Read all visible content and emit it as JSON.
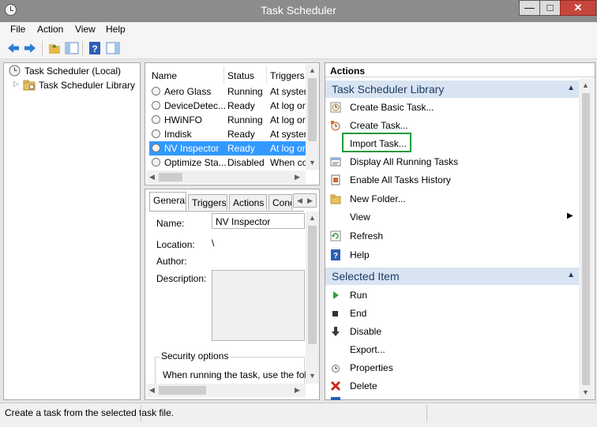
{
  "window": {
    "title": "Task Scheduler"
  },
  "menu": [
    "File",
    "Action",
    "View",
    "Help"
  ],
  "tree": {
    "root": "Task Scheduler (Local)",
    "child": "Task Scheduler Library"
  },
  "tasks": {
    "columns": [
      "Name",
      "Status",
      "Triggers"
    ],
    "rows": [
      {
        "name": "Aero Glass",
        "status": "Running",
        "triggers": "At systen",
        "selected": false
      },
      {
        "name": "DeviceDetec...",
        "status": "Ready",
        "triggers": "At log or",
        "selected": false
      },
      {
        "name": "HWiNFO",
        "status": "Running",
        "triggers": "At log or",
        "selected": false
      },
      {
        "name": "Imdisk",
        "status": "Ready",
        "triggers": "At systen",
        "selected": false
      },
      {
        "name": "NV Inspector",
        "status": "Ready",
        "triggers": "At log or",
        "selected": true
      },
      {
        "name": "Optimize Sta...",
        "status": "Disabled",
        "triggers": "When co",
        "selected": false
      }
    ]
  },
  "detail": {
    "tabs": [
      "General",
      "Triggers",
      "Actions",
      "Conc"
    ],
    "name_label": "Name:",
    "name_value": "NV Inspector",
    "location_label": "Location:",
    "location_value": "\\",
    "author_label": "Author:",
    "description_label": "Description:",
    "security_label": "Security options",
    "security_text": "When running the task, use the follo"
  },
  "actions": {
    "header": "Actions",
    "section1_title": "Task Scheduler Library",
    "section1_items": [
      "Create Basic Task...",
      "Create Task...",
      "Import Task...",
      "Display All Running Tasks",
      "Enable All Tasks History",
      "New Folder...",
      "View",
      "Refresh",
      "Help"
    ],
    "section2_title": "Selected Item",
    "section2_items": [
      "Run",
      "End",
      "Disable",
      "Export...",
      "Properties",
      "Delete"
    ],
    "highlight_color": "#1e9a3c"
  },
  "status": {
    "text": "Create a task from the selected task file."
  }
}
